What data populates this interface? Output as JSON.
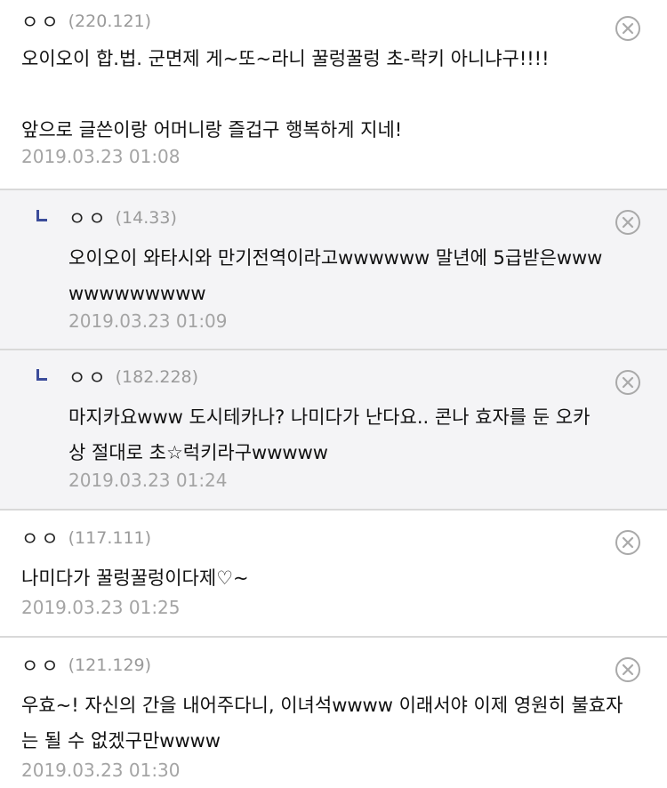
{
  "comments": [
    {
      "nickname": "ㅇㅇ",
      "ip": "(220.121)",
      "text": "오이오이 합.법. 군면제 게~또~라니 꿀렁꿀렁 초-락키 아니냐구!!!!\n\n앞으로 글쓴이랑 어머니랑 즐겁구 행복하게 지네!",
      "date": "2019.03.23 01:08",
      "is_reply": false
    },
    {
      "nickname": "ㅇㅇ",
      "ip": "(14.33)",
      "text": "오이오이 와타시와 만기전역이라고wwwwww 말년에 5급받은wwwwwwwwwwww",
      "date": "2019.03.23 01:09",
      "is_reply": true
    },
    {
      "nickname": "ㅇㅇ",
      "ip": "(182.228)",
      "text": "마지카요www 도시테카나? 나미다가 난다요.. 콘나 효자를 둔 오카상 절대로 초☆럭키라구wwwww",
      "date": "2019.03.23 01:24",
      "is_reply": true
    },
    {
      "nickname": "ㅇㅇ",
      "ip": "(117.111)",
      "text": "나미다가 꿀렁꿀렁이다제♡~",
      "date": "2019.03.23 01:25",
      "is_reply": false
    },
    {
      "nickname": "ㅇㅇ",
      "ip": "(121.129)",
      "text": "우효~! 자신의 간을 내어주다니, 이녀석wwww 이래서야 이제 영원히 불효자는 될 수 없겠구만wwww",
      "date": "2019.03.23 01:30",
      "is_reply": false
    }
  ],
  "icons": {
    "delete": "close-circle-icon",
    "reply_marker": "reply-arrow-icon"
  },
  "colors": {
    "reply_background": "#f4f4f6",
    "reply_marker": "#3b4c9a",
    "meta_text": "#a4a4a4",
    "divider": "#d9d9d9"
  }
}
